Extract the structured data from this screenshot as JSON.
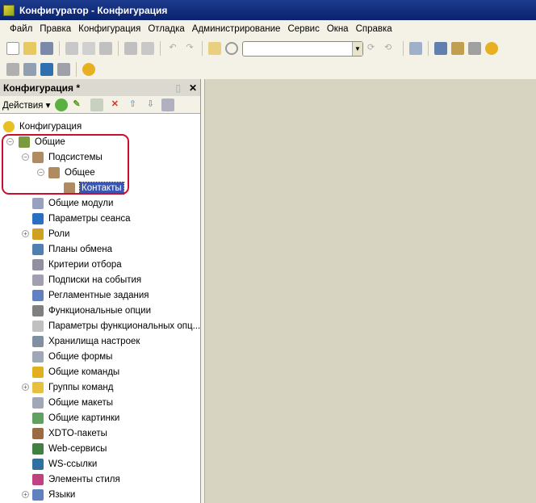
{
  "window": {
    "title": "Конфигуратор - Конфигурация"
  },
  "menu": [
    "Файл",
    "Правка",
    "Конфигурация",
    "Отладка",
    "Администрирование",
    "Сервис",
    "Окна",
    "Справка"
  ],
  "search": {
    "value": ""
  },
  "panel": {
    "title": "Конфигурация *",
    "actions_label": "Действия ▾",
    "close": "✕",
    "pin": "▯"
  },
  "tree": [
    {
      "label": "Конфигурация",
      "level": 0,
      "toggle": "",
      "color": "#e8c020"
    },
    {
      "label": "Общие",
      "level": 1,
      "toggle": "−",
      "color": "#7a9a40"
    },
    {
      "label": "Подсистемы",
      "level": 2,
      "toggle": "−",
      "color": "#b08a60"
    },
    {
      "label": "Общее",
      "level": 3,
      "toggle": "−",
      "color": "#b08a60"
    },
    {
      "label": "Контакты",
      "level": 4,
      "toggle": "",
      "color": "#b08a60",
      "selected": true
    },
    {
      "label": "Общие модули",
      "level": 2,
      "toggle": "",
      "color": "#9aa0c0"
    },
    {
      "label": "Параметры сеанса",
      "level": 2,
      "toggle": "",
      "color": "#2a70c0"
    },
    {
      "label": "Роли",
      "level": 2,
      "toggle": "+",
      "color": "#d0a020"
    },
    {
      "label": "Планы обмена",
      "level": 2,
      "toggle": "",
      "color": "#5080b0"
    },
    {
      "label": "Критерии отбора",
      "level": 2,
      "toggle": "",
      "color": "#9090a0"
    },
    {
      "label": "Подписки на события",
      "level": 2,
      "toggle": "",
      "color": "#a0a0b0"
    },
    {
      "label": "Регламентные задания",
      "level": 2,
      "toggle": "",
      "color": "#6080c0"
    },
    {
      "label": "Функциональные опции",
      "level": 2,
      "toggle": "",
      "color": "#808080"
    },
    {
      "label": "Параметры функциональных опц...",
      "level": 2,
      "toggle": "",
      "color": "#c0c0c0"
    },
    {
      "label": "Хранилища настроек",
      "level": 2,
      "toggle": "",
      "color": "#8090a0"
    },
    {
      "label": "Общие формы",
      "level": 2,
      "toggle": "",
      "color": "#a0a8b8"
    },
    {
      "label": "Общие команды",
      "level": 2,
      "toggle": "",
      "color": "#e0b020"
    },
    {
      "label": "Группы команд",
      "level": 2,
      "toggle": "+",
      "color": "#e8c040"
    },
    {
      "label": "Общие макеты",
      "level": 2,
      "toggle": "",
      "color": "#a0a8b8"
    },
    {
      "label": "Общие картинки",
      "level": 2,
      "toggle": "",
      "color": "#60a060"
    },
    {
      "label": "XDTO-пакеты",
      "level": 2,
      "toggle": "",
      "color": "#9a6a40"
    },
    {
      "label": "Web-сервисы",
      "level": 2,
      "toggle": "",
      "color": "#408040"
    },
    {
      "label": "WS-ссылки",
      "level": 2,
      "toggle": "",
      "color": "#3070a0"
    },
    {
      "label": "Элементы стиля",
      "level": 2,
      "toggle": "",
      "color": "#c04080"
    },
    {
      "label": "Языки",
      "level": 2,
      "toggle": "+",
      "color": "#6080c0"
    }
  ]
}
